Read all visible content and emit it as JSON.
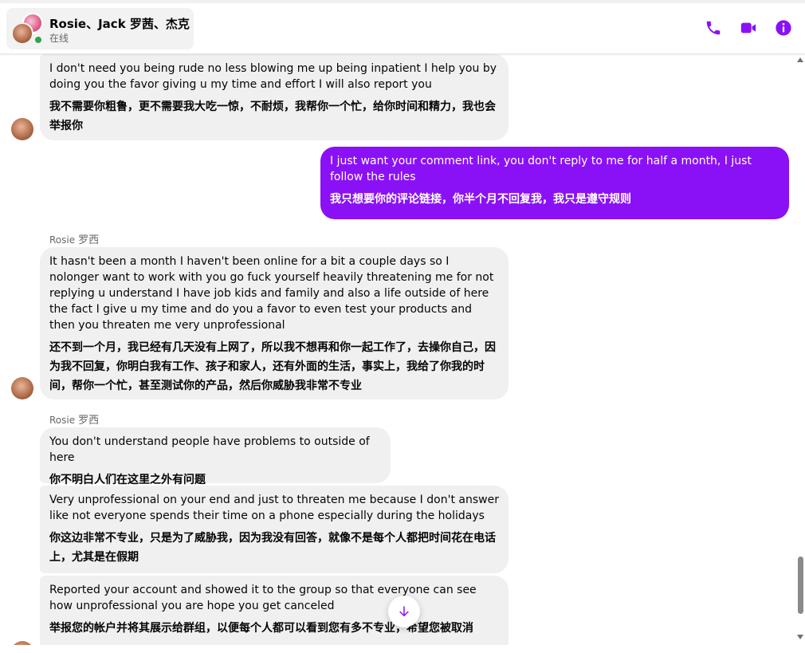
{
  "header": {
    "contact_name": "Rosie、Jack  罗茜、杰克",
    "status": "在线",
    "accent_color": "#8a11f5",
    "icons": [
      "phone-icon",
      "video-icon",
      "info-icon"
    ]
  },
  "messages": [
    {
      "original": "I don't need you being rude no less blowing me up being inpatient I help you by doing you the favor giving u my time and effort I will also report you",
      "translation": "我不需要你粗鲁，更不需要我大吃一惊，不耐烦，我帮你一个忙，给你时间和精力，我也会举报你"
    },
    {
      "original": "I just want your comment link, you don't reply to me for half a month, I just follow the rules",
      "translation": "我只想要你的评论链接，你半个月不回复我，我只是遵守规则"
    },
    {
      "sender": "Rosie",
      "sender_cn": "罗西",
      "original": "It hasn't been a month I haven't been online for a bit a couple days so I nolonger want to work with you go fuck yourself heavily threatening me for not replying u understand I have job kids and family and also a life outside of here the fact I give u my time and do you a favor to even test your products and then you threaten me very unprofessional",
      "translation": "还不到一个月，我已经有几天没有上网了，所以我不想再和你一起工作了，去操你自己，因为我不回复，你明白我有工作、孩子和家人，还有外面的生活，事实上，我给了你我的时间，帮你一个忙，甚至测试你的产品，然后你威胁我非常不专业"
    },
    {
      "sender": "Rosie",
      "sender_cn": "罗西",
      "original": "You don't understand people have problems to outside of here",
      "translation": "你不明白人们在这里之外有问题"
    },
    {
      "original": "Very unprofessional on your end and just to threaten me because I don't answer like not everyone spends their time on a phone especially during the holidays",
      "translation": "你这边非常不专业，只是为了威胁我，因为我没有回答，就像不是每个人都把时间花在电话上，尤其是在假期"
    },
    {
      "original": "Reported your account and showed it to the group so that everyone can see how unprofessional you are hope you get canceled",
      "translation": "举报您的帐户并将其展示给群组，以便每个人都可以看到您有多不专业，希望您被取消"
    }
  ],
  "scroll_button_icon": "arrow-down-icon"
}
